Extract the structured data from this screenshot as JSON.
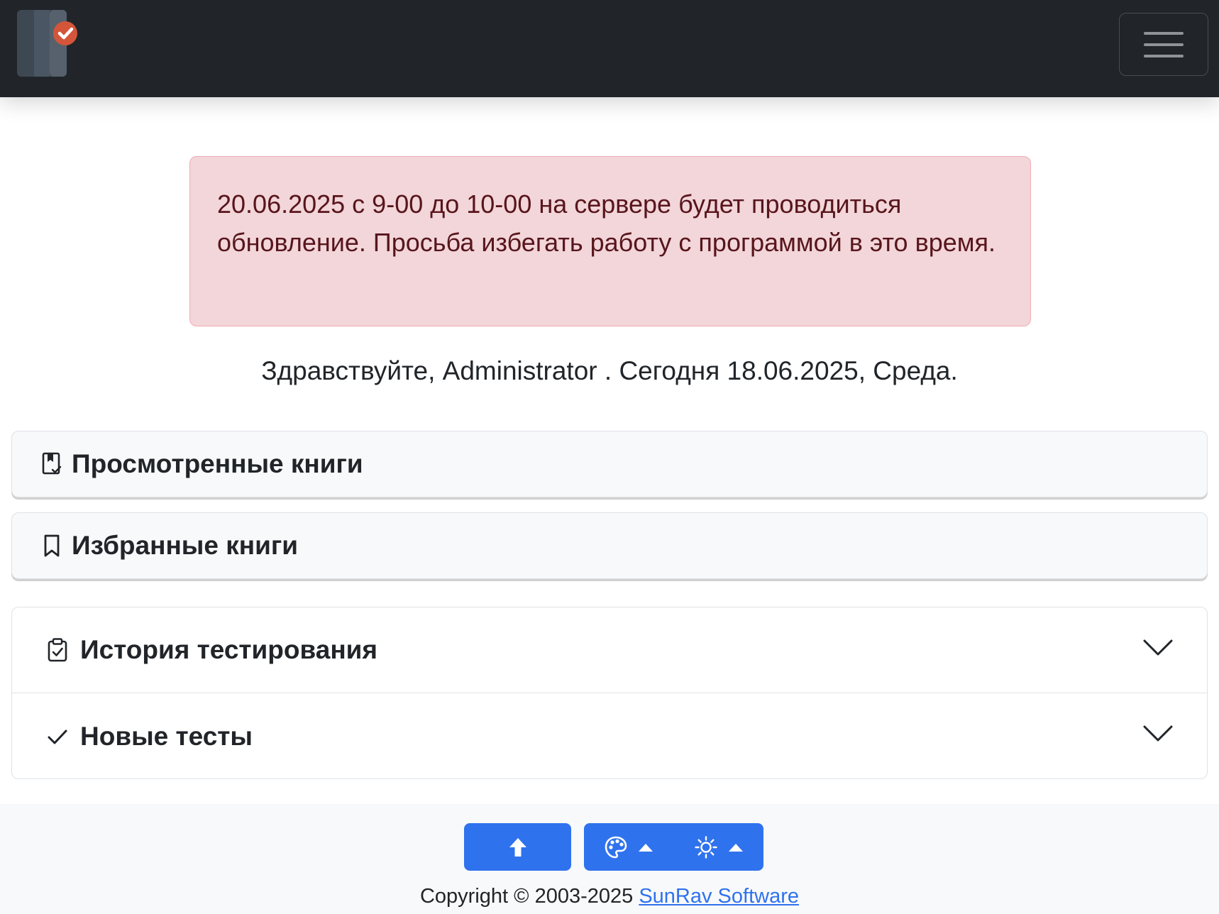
{
  "navbar": {
    "logo_icon": "app-logo-book-check",
    "menu_icon": "hamburger-icon",
    "background": "#212529"
  },
  "alert": {
    "text": "20.06.2025 с 9-00 до 10-00 на сервере будет проводиться обновление. Просьба избегать работу с программой в это время.",
    "background": "#f2d6d9",
    "text_color": "#58151c"
  },
  "greeting": {
    "text": "Здравствуйте, Administrator . Сегодня 18.06.2025, Среда."
  },
  "sections": {
    "viewed_books": {
      "label": "Просмотренные книги",
      "icon": "bookmark-check-icon"
    },
    "favorite_books": {
      "label": "Избранные книги",
      "icon": "bookmark-icon"
    }
  },
  "accordion": {
    "items": [
      {
        "label": "История тестирования",
        "icon": "clipboard-check-icon",
        "expand_icon": "chevron-down-icon"
      },
      {
        "label": "Новые тесты",
        "icon": "check-icon",
        "expand_icon": "chevron-down-icon"
      }
    ]
  },
  "footer": {
    "scroll_top_icon": "arrow-up-icon",
    "theme_icon": "palette-icon",
    "mode_icon": "sun-icon",
    "accent": "#2f72ee",
    "copyright_text": "Copyright © 2003-2025",
    "company_link": "SunRav Software"
  }
}
